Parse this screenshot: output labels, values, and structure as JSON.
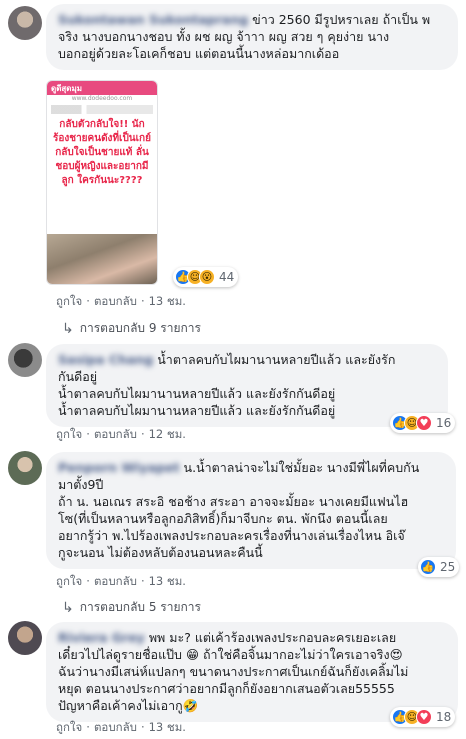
{
  "comments": [
    {
      "author": "Sukontawan Sukontaprang",
      "text": "ข่าว 2560 มีรูปหราเลย ถ้าเป็น พ\nจริง นางบอกนางชอบ ทั้ง ผช ผญ จ้าาา ผญ สวย ๆ คุยง่าย นาง\nบอกอยู่ด้วยละโอเคก็ชอบ แต่ตอนนี้นางหล่อมากเด้ออ",
      "image": {
        "site": "ดูดีสุดมุม",
        "url": "www.dodeedoo.com",
        "headline": "กลับตัวกลับใจ!! นักร้องชายคนดังที่เป็นเกย์ กลับใจเป็นชายแท้ ลั่นชอบผู้หญิงและอยากมีลูก ใครกันนะ????"
      },
      "reaction_count": "44",
      "like": "ถูกใจ",
      "reply": "ตอบกลับ",
      "time": "13 ชม.",
      "replies": "การตอบกลับ 9 รายการ"
    },
    {
      "author": "Sasipa Chang",
      "text": "น้ำตาลคบกับไผมานานหลายปีแล้ว และยังรัก\nกันดีอยู่\nน้ำตาลคบกับไผมานานหลายปีแล้ว และยังรักกันดีอยู่\nน้ำตาลคบกับไผมานานหลายปีแล้ว และยังรักกันดีอยู่",
      "reaction_count": "16",
      "like": "ถูกใจ",
      "reply": "ตอบกลับ",
      "time": "12 ชม."
    },
    {
      "author": "Penporn Wiyapet",
      "text": "น.น้ำตาลน่าจะไม่ใช่มั้ยอะ นางมีพี่ไผที่คบกัน\nมาตั้ง9ปี\nถ้า น. นอเณร สระอิ ชอช้าง สระอา อาจจะมั้ยอะ นางเคยมีแฟนไฮ\nโซ(ที่เป็นหลานหรือลูกอภิสิทธิ์)ก็มาจีบกะ ตน. พักนึง ตอนนี้เลย\nอยากรู้ว่า พ.ไปร้องเพลงประกอบละครเรื่องที่นางเล่นเรื่องไหน อิเจ๊\nกูจะนอน ไม่ต้องหลับต้องนอนหละคืนนี้",
      "reaction_count": "25",
      "like": "ถูกใจ",
      "reply": "ตอบกลับ",
      "time": "13 ชม.",
      "replies": "การตอบกลับ 5 รายการ"
    },
    {
      "author": "Riviera Grey",
      "text": "พพ มะ? แต่เค้าร้องเพลงประกอบละครเยอะเลย\nเดี๋ยวไปไล่ดูรายชื่อแป๊บ 😁 ถ้าใช่คือจิ้นมากอะไม่ว่าใครเอาจริง😍\nฉันว่านางมีเสน่ห์แปลกๆ ขนาดนางประกาศเป็นเกย์ฉันก็ยังเคลิ้มไม่\nหยุด ตอนนางประกาศว่าอยากมีลูกก็ยังอยากเสนอตัวเลย55555\nปัญหาคือเค้าคงไม่เอากู🤣",
      "reaction_count": "18",
      "like": "ถูกใจ",
      "reply": "ตอบกลับ",
      "time": "13 ชม."
    }
  ],
  "icons": {
    "like": "thumbs-up",
    "laugh": "laugh-face",
    "love": "heart",
    "wow": "wow-face",
    "reply_arrow": "reply-arrow"
  },
  "colors": {
    "author": "#385898",
    "bubble": "#f2f3f5",
    "like_blue": "#1877f2",
    "love_red": "#f33e58",
    "emoji_yellow": "#f7b125",
    "headline_red": "#e8264a",
    "site_pink": "#e84a7f"
  }
}
